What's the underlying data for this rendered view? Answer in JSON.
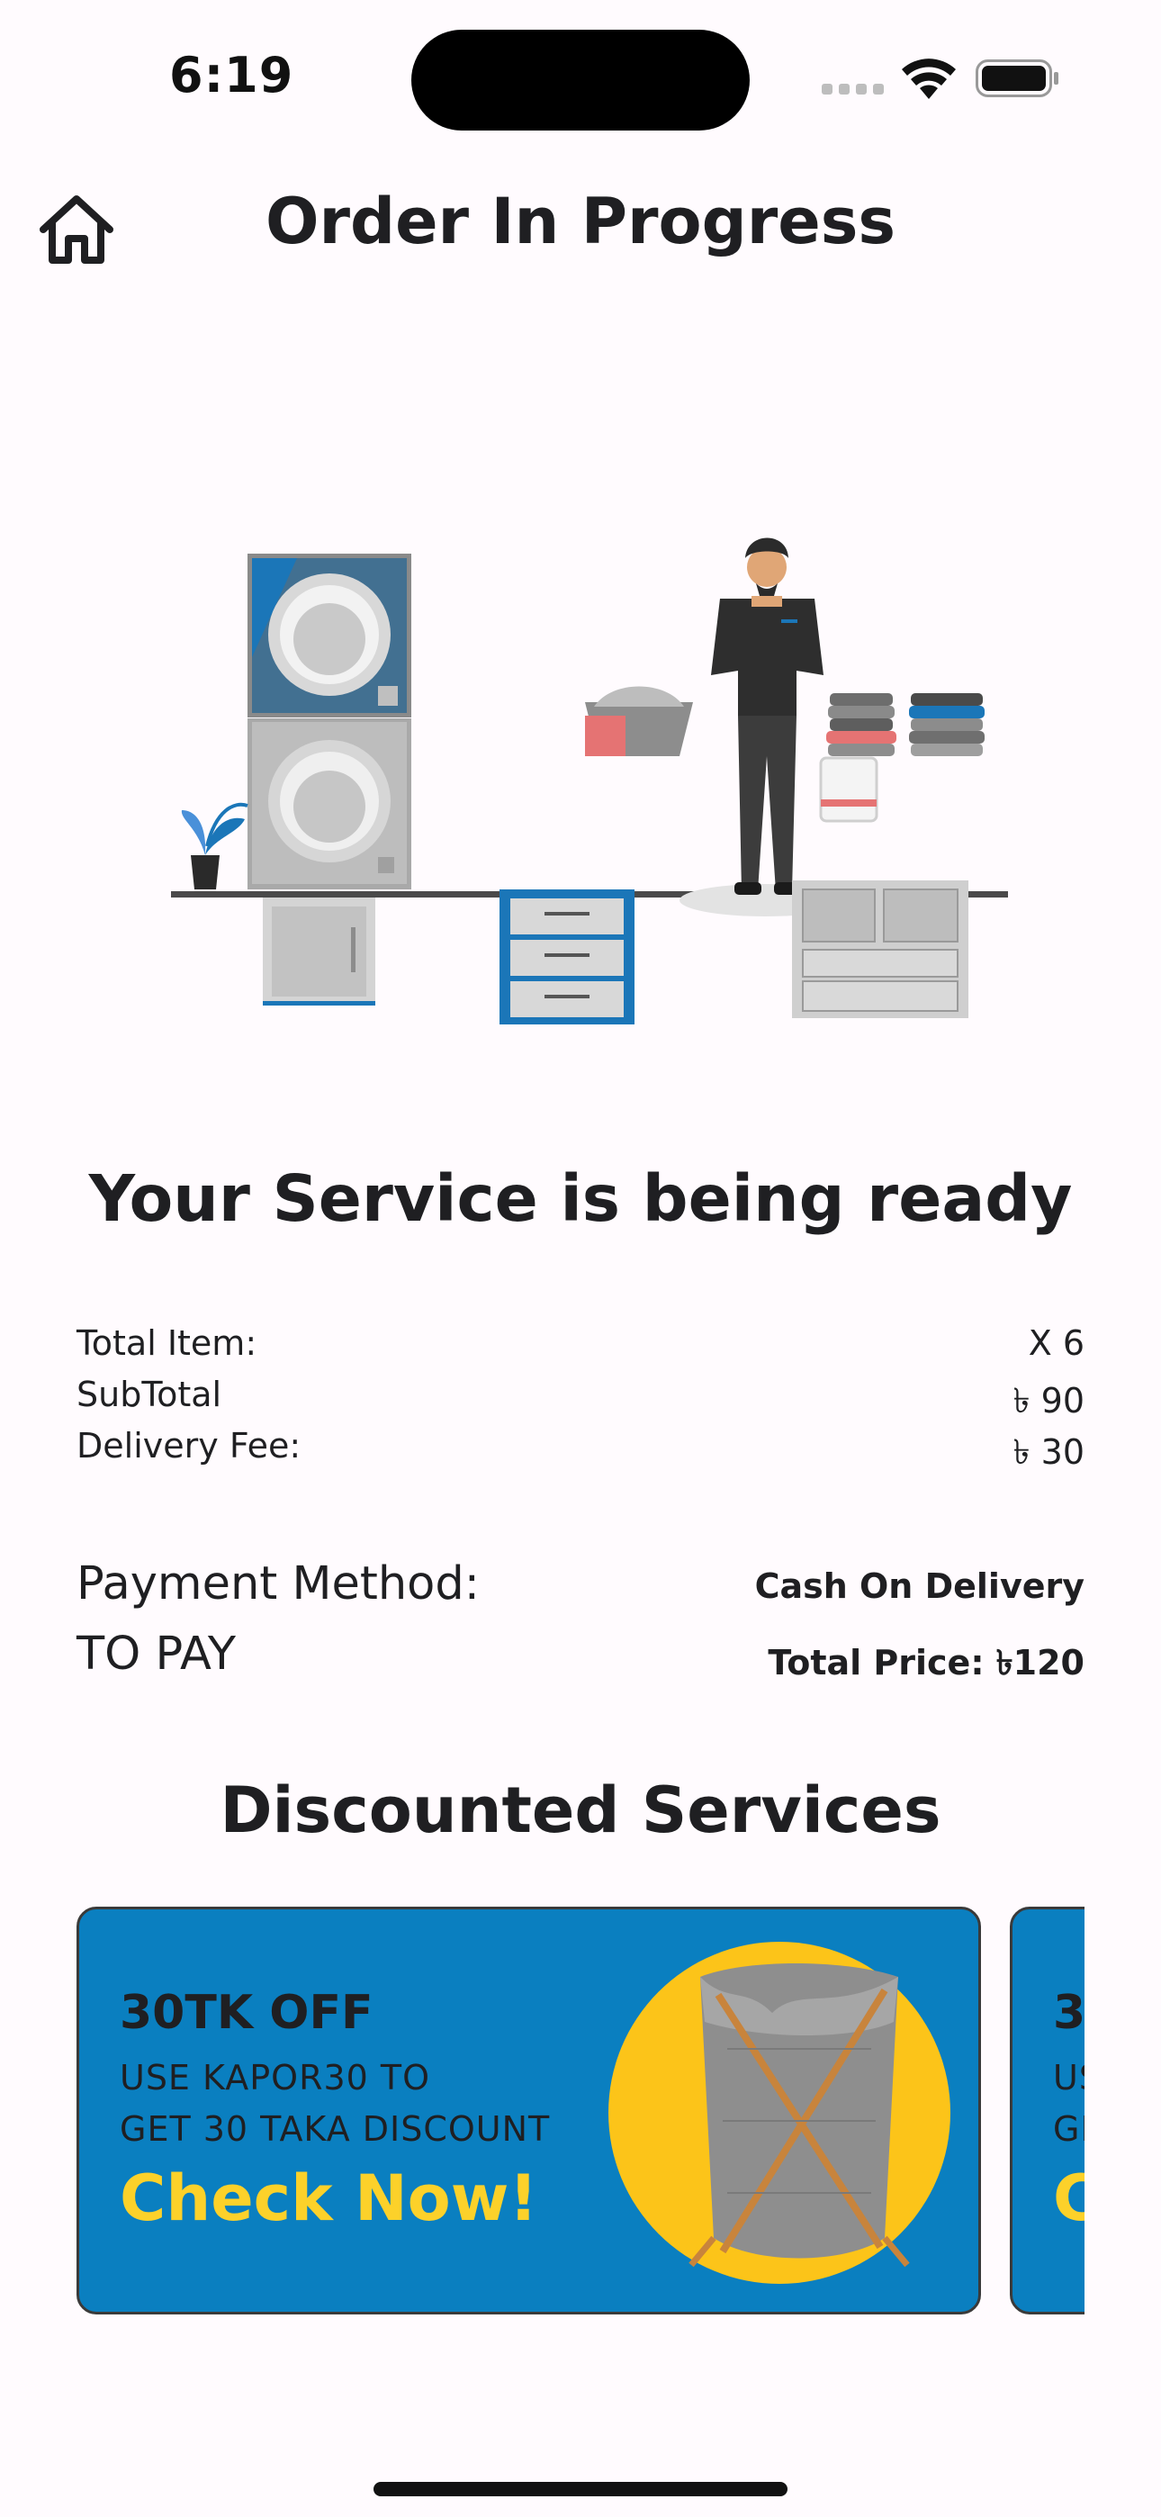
{
  "status_bar": {
    "time": "6:19"
  },
  "header": {
    "title": "Order In Progress",
    "home_icon": "home-icon"
  },
  "main": {
    "service_heading": "Your Service is being ready",
    "summary": [
      {
        "label": "Total Item:",
        "value": "X 6"
      },
      {
        "label": "SubTotal",
        "value": "৳ 90"
      },
      {
        "label": "Delivery Fee:",
        "value": "৳ 30"
      }
    ],
    "payment": {
      "method_label": "Payment Method:",
      "method_value": "Cash On Delivery",
      "to_pay_label": "TO PAY",
      "total_price": "Total Price: ৳120"
    },
    "discount_heading": "Discounted Services",
    "promos": [
      {
        "title": "30TK OFF",
        "line1": "USE KAPOR30 TO",
        "line2": "GET 30 TAKA DISCOUNT",
        "cta": "Check Now!"
      },
      {
        "title": "3",
        "line1": "US",
        "line2": "GI",
        "cta": "C"
      }
    ]
  },
  "colors": {
    "background": "#fffbfe",
    "promo_blue": "#0a7fc0",
    "promo_yellow": "#fcd12a",
    "text": "#1f1f22"
  }
}
